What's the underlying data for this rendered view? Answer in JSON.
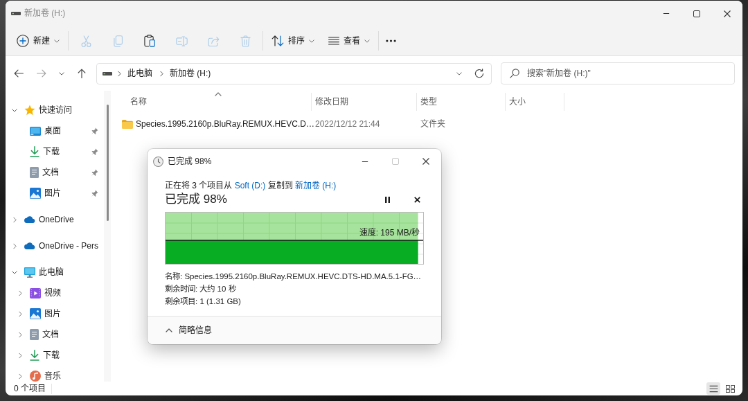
{
  "window": {
    "title": "新加卷 (H:)",
    "controls": [
      {
        "kind": "minimize",
        "disabled": false
      },
      {
        "kind": "maximize",
        "disabled": false
      },
      {
        "kind": "close",
        "disabled": false
      }
    ]
  },
  "command_bar": {
    "new_button": {
      "label": "新建"
    },
    "actions": [
      {
        "kind": "cut",
        "disabled": true
      },
      {
        "kind": "copy",
        "disabled": true
      },
      {
        "kind": "paste",
        "disabled": false
      },
      {
        "kind": "rename",
        "disabled": true
      },
      {
        "kind": "share",
        "disabled": true
      },
      {
        "kind": "delete",
        "disabled": true
      }
    ],
    "sort_button": {
      "label": "排序"
    },
    "view_button": {
      "label": "查看"
    }
  },
  "navigation": [
    {
      "kind": "back",
      "disabled": false
    },
    {
      "kind": "forward",
      "disabled": true
    },
    {
      "kind": "recent",
      "disabled": false
    },
    {
      "kind": "up",
      "disabled": false
    }
  ],
  "address_bar": {
    "breadcrumbs": [
      "此电脑",
      "新加卷 (H:)"
    ]
  },
  "search": {
    "placeholder": "搜索\"新加卷 (H:)\""
  },
  "sidebar": {
    "items": [
      {
        "label": "快速访问",
        "kind": "quick-access",
        "expanded": true,
        "children": [
          {
            "label": "桌面",
            "kind": "desktop",
            "pinned": true
          },
          {
            "label": "下载",
            "kind": "downloads",
            "pinned": true
          },
          {
            "label": "文档",
            "kind": "documents",
            "pinned": true
          },
          {
            "label": "图片",
            "kind": "pictures",
            "pinned": true
          }
        ]
      },
      {
        "label": "OneDrive",
        "kind": "cloud",
        "expanded": false
      },
      {
        "label": "OneDrive - Pers",
        "kind": "cloud",
        "expanded": false
      },
      {
        "label": "此电脑",
        "kind": "computer",
        "expanded": true,
        "children": [
          {
            "label": "视频",
            "kind": "videos",
            "expanded": false
          },
          {
            "label": "图片",
            "kind": "pictures",
            "expanded": false
          },
          {
            "label": "文档",
            "kind": "documents",
            "expanded": false
          },
          {
            "label": "下载",
            "kind": "downloads",
            "expanded": false
          },
          {
            "label": "音乐",
            "kind": "music",
            "expanded": false
          }
        ]
      }
    ]
  },
  "file_list": {
    "columns": [
      {
        "label": "名称",
        "sorted": true
      },
      {
        "label": "修改日期",
        "sorted": false
      },
      {
        "label": "类型",
        "sorted": false
      },
      {
        "label": "大小",
        "sorted": false
      }
    ],
    "rows": [
      {
        "kind": "folder",
        "name": "Species.1995.2160p.BluRay.REMUX.HEVC.D…",
        "modified": "2022/12/12 21:44",
        "type": "文件夹"
      }
    ]
  },
  "status_bar": {
    "item_count": "0 个项目",
    "view_buttons": [
      {
        "kind": "details",
        "selected": true
      },
      {
        "kind": "tiles",
        "selected": false
      }
    ]
  },
  "copy_dialog": {
    "title": "已完成 98%",
    "controls": [
      {
        "kind": "minimize",
        "disabled": false
      },
      {
        "kind": "maximize",
        "disabled": true
      },
      {
        "kind": "close",
        "disabled": false
      }
    ],
    "description": [
      {
        "kind": "text",
        "text": "正在将 3 个项目从 "
      },
      {
        "kind": "link",
        "text": "Soft (D:)"
      },
      {
        "kind": "text",
        "text": " 复制到 "
      },
      {
        "kind": "link",
        "text": "新加卷 (H:)"
      }
    ],
    "status": "已完成 98%",
    "progress": {
      "level": 0.98,
      "speed": "速度: 195 MB/秒"
    },
    "details": [
      "名称: Species.1995.2160p.BluRay.REMUX.HEVC.DTS-HD.MA.5.1-FG…",
      "剩余时间: 大约 10 秒",
      "剩余项目: 1 (1.31 GB)"
    ],
    "footer_button": {
      "label": "简略信息"
    }
  }
}
